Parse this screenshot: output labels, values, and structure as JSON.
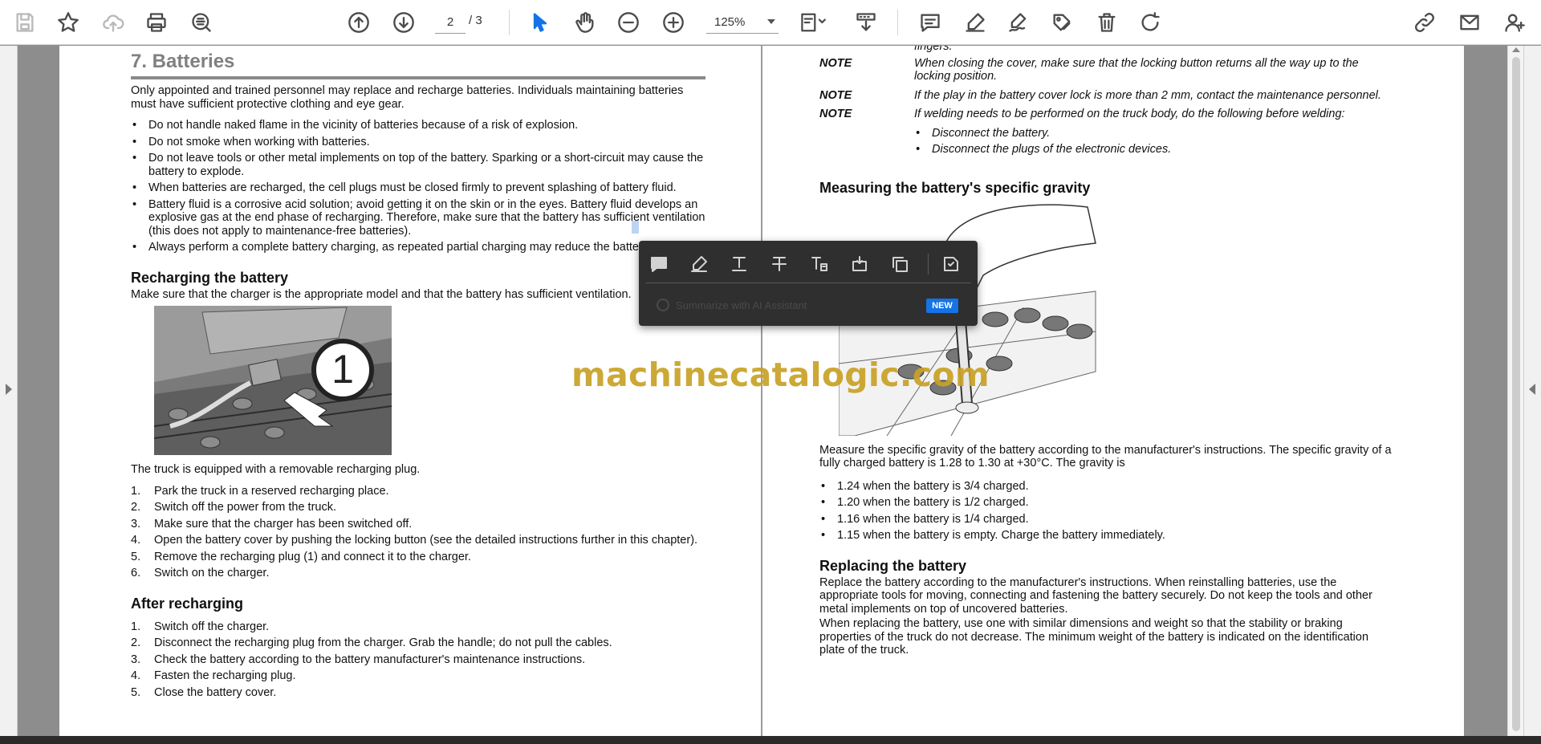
{
  "toolbar": {
    "page_current": "2",
    "page_total": "/ 3",
    "zoom": "125%",
    "icons": [
      "save-icon",
      "star-icon",
      "cloud-upload-icon",
      "print-icon",
      "zoom-search-icon",
      "page-up-icon",
      "page-down-icon",
      "select-cursor-icon",
      "hand-icon",
      "zoom-out-icon",
      "zoom-in-icon",
      "page-fit-icon",
      "scroll-mode-icon",
      "comment-icon",
      "highlight-icon",
      "sign-icon",
      "stamp-icon",
      "delete-icon",
      "rotate-icon",
      "share-link-icon",
      "email-icon",
      "add-user-icon"
    ]
  },
  "left_page": {
    "title": "7. Batteries",
    "intro": "Only appointed and trained personnel may replace and recharge batteries. Individuals maintaining batteries must have sufficient protective clothing and eye gear.",
    "bullets": [
      "Do not handle naked flame in the vicinity of batteries because of a risk of explosion.",
      "Do not smoke when working with batteries.",
      "Do not leave tools or other metal implements on top of the battery. Sparking or a short-circuit may cause the battery to explode.",
      "When batteries are recharged, the cell plugs must be closed firmly to prevent splashing of battery fluid.",
      "Battery fluid is a corrosive acid solution; avoid getting it on the skin or in the eyes. Battery fluid develops an explosive gas at the end phase of recharging. Therefore, make sure that the battery has sufficient ventilation (this does not apply to maintenance-free batteries).",
      "Always perform a complete battery charging, as repeated partial charging may reduce the batte"
    ],
    "recharging_heading": "Recharging the battery",
    "recharging_intro": "Make sure that the charger is the appropriate model and that the battery has sufficient ventilation.",
    "figure_callout": "1",
    "plug_text": "The truck is equipped with a removable recharging plug.",
    "recharge_steps": [
      {
        "n": "1.",
        "t": "Park the truck in a reserved recharging place."
      },
      {
        "n": "2.",
        "t": "Switch off the power from the truck."
      },
      {
        "n": "3.",
        "t": "Make sure that the charger has been switched off."
      },
      {
        "n": "4.",
        "t": "Open the battery cover by pushing the locking button (see the detailed instructions further in this chapter)."
      },
      {
        "n": "5.",
        "t": "Remove the recharging plug (1) and connect it to the charger."
      },
      {
        "n": "6.",
        "t": "Switch on the charger."
      }
    ],
    "after_heading": "After recharging",
    "after_steps": [
      {
        "n": "1.",
        "t": "Switch off the charger."
      },
      {
        "n": "2.",
        "t": "Disconnect the recharging plug from the charger. Grab the handle; do not pull the cables."
      },
      {
        "n": "3.",
        "t": "Check the battery according to the battery manufacturer's maintenance instructions."
      },
      {
        "n": "4.",
        "t": "Fasten the recharging plug."
      },
      {
        "n": "5.",
        "t": "Close the battery cover."
      }
    ]
  },
  "right_page": {
    "top_fragment": "fingers.",
    "notes": [
      {
        "label": "NOTE",
        "text": "When closing the cover, make sure that the locking button returns all the way up to the locking position."
      },
      {
        "label": "NOTE",
        "text": "If the play in the battery cover lock is more than 2 mm, contact the maintenance personnel."
      },
      {
        "label": "NOTE",
        "text": "If welding needs to be performed on the truck body, do the following before welding:"
      }
    ],
    "welding_steps": [
      "Disconnect the battery.",
      "Disconnect the plugs of the electronic devices."
    ],
    "gravity_heading": "Measuring the battery's specific gravity",
    "gravity_text": "Measure the specific gravity of the battery according to the manufacturer's instructions. The specific gravity of a fully charged battery is 1.28 to 1.30 at +30°C. The gravity is",
    "gravity_values": [
      "1.24 when the battery is 3/4 charged.",
      "1.20 when the battery is 1/2 charged.",
      "1.16 when the battery is 1/4 charged.",
      "1.15 when the battery is empty. Charge the battery immediately."
    ],
    "replacing_heading": "Replacing the battery",
    "replacing_p1": "Replace the battery according to the manufacturer's instructions. When reinstalling batteries, use the appropriate tools for moving, connecting and fastening the battery securely. Do not keep the tools and other metal implements on top of uncovered batteries.",
    "replacing_p2": "When replacing the battery, use one with similar dimensions and weight so that the stability or braking properties of the truck do not decrease. The minimum weight of the battery is indicated on the identification plate of the truck."
  },
  "popup": {
    "ai_text": "Summarize with AI Assistant",
    "new_badge": "NEW"
  },
  "watermark": "machinecatalogic.com"
}
